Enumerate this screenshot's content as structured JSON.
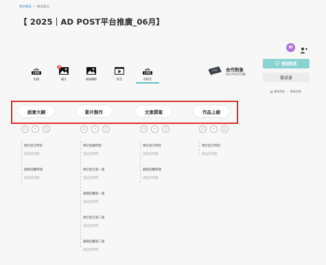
{
  "breadcrumb": {
    "home": "我的專案",
    "current": "專案概況"
  },
  "page_title": "【 2025｜AD POST平台推廣_06月】",
  "avatar": {
    "initial": "M",
    "color": "#b070d8"
  },
  "content_tabs": [
    {
      "label": "貼播",
      "icon": "live-icon",
      "badge": "LIVE"
    },
    {
      "label": "圖文",
      "icon": "image-icon",
      "notification": "1"
    },
    {
      "label": "開箱體驗",
      "icon": "image-icon"
    },
    {
      "label": "影音",
      "icon": "video-play-icon"
    },
    {
      "label": "短影音",
      "icon": "live-icon",
      "badge": "LIVE"
    }
  ],
  "partner": {
    "title": "合作對象",
    "subtitle": "AD POST行銷"
  },
  "actions": {
    "send_message": "發送訊息",
    "requirements": "需求單",
    "schedule_link": "專案時程",
    "status_link": "驗收狀態"
  },
  "stages": [
    {
      "label": "創意大綱"
    },
    {
      "label": "影片製作"
    },
    {
      "label": "文案撰寫"
    },
    {
      "label": "作品上線"
    }
  ],
  "entries": {
    "creative_outline": [
      {
        "label": "預計提交時程",
        "value": "請設定時間"
      },
      {
        "label": "最晚回覆時間",
        "value": "請設定時間"
      }
    ],
    "video_production": [
      {
        "label": "預計拍攝時程",
        "value": "請設定時間"
      },
      {
        "label": "預計提交第一版",
        "value": "請設定時間"
      },
      {
        "label": "最晚回覆第一版",
        "value": "請設定時間"
      },
      {
        "label": "預計提交第二版",
        "value": "請設定時間"
      },
      {
        "label": "最晚回覆第二版",
        "value": "請設定時間"
      }
    ],
    "copywriting": [
      {
        "label": "預計提交時程",
        "value": "請設定時間"
      },
      {
        "label": "最晚回覆時間",
        "value": "請設定時間"
      }
    ],
    "go_live": [
      {
        "label": "預計提交時程",
        "value": "請設定時間"
      }
    ]
  },
  "colors": {
    "accent": "#8bd3d3",
    "highlight_frame": "#e02a2a",
    "active_tab": "#5cc0c0"
  }
}
